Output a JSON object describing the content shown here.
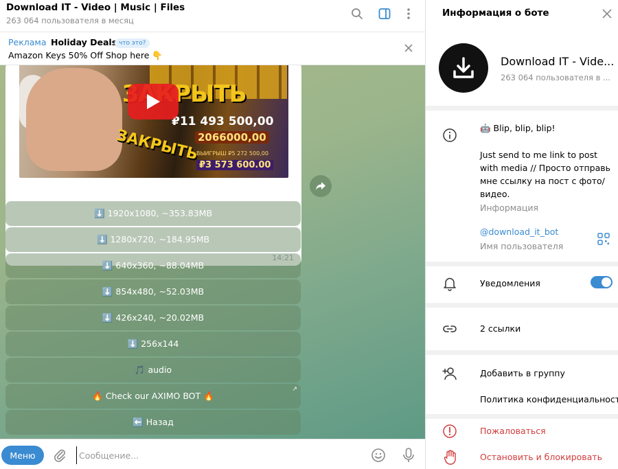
{
  "chat": {
    "title": "Download IT - Video | Music | Files",
    "subtitle": "263 064 пользователя в месяц",
    "icons": [
      "search-icon",
      "columns-icon",
      "more-vertical-icon"
    ]
  },
  "ad": {
    "label": "Реклама",
    "title": "Holiday Deals",
    "what_is_it": "что это?",
    "text": "Amazon Keys 50% Off Shop here 👇"
  },
  "message": {
    "thumbnail_text": {
      "overlay_big": "ЗАКРЫТЬ",
      "amount_1": "₽11 493 500,00",
      "amount_2": "2066000,00",
      "win_label": "ВЫИГРЫШ ₽5 272 500,00",
      "amount_3": "₽3 573 600.00",
      "overlay_small": "ЗАКРЫТЬ"
    },
    "time": "14:21"
  },
  "bot_buttons": [
    {
      "label": "⬇️ 1920x1080, ~353.83MB"
    },
    {
      "label": "⬇️ 1280x720, ~184.95MB"
    },
    {
      "label": "⬇️ 640x360, ~88.04MB"
    },
    {
      "label": "⬇️ 854x480, ~52.03MB"
    },
    {
      "label": "⬇️ 426x240, ~20.02MB"
    },
    {
      "label": "⬇️ 256x144"
    },
    {
      "label": "🎵 audio"
    },
    {
      "label": "🔥 Check our AXIMO BOT 🔥"
    },
    {
      "label": "⬅️ Назад"
    }
  ],
  "composer": {
    "menu_label": "Меню",
    "placeholder": "Сообщение..."
  },
  "panel": {
    "title": "Информация о боте",
    "bot_name": "Download IT - Vide...",
    "bot_subtitle": "263 064 пользователя в ...",
    "bio_first": "🤖 Blip, blip, blip!",
    "bio": "Just send to me link to post with media // Просто отправь мне ссылку на пост с фото/видео.",
    "bio_caption": "Информация",
    "username": "@download_it_bot",
    "username_caption": "Имя пользователя",
    "notifications": "Уведомления",
    "notifications_on": true,
    "links": "2 ссылки",
    "add_to_group": "Добавить в группу",
    "privacy": "Политика конфиденциальност...",
    "report": "Пожаловаться",
    "block": "Остановить и блокировать"
  },
  "colors": {
    "accent": "#3a8bd1",
    "danger": "#d13c3c",
    "muted": "#8c8c8c"
  }
}
